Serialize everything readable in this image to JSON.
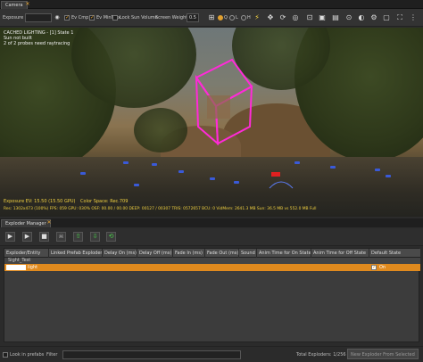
{
  "camera_panel": {
    "tab_label": "Camera",
    "toolbar": {
      "exposure_label": "Exposure",
      "ev_cmp_label": "Ev Cmp",
      "ev_minmax_label": "Ev MinMax",
      "lock_sun_label": "Lock Sun Volume",
      "screen_weight_label": "Screen Weight",
      "screen_weight_value": "0.5",
      "view_modes": [
        "Q",
        "L",
        "H"
      ]
    },
    "overlay": {
      "line1": "CACHED LIGHTING - [1] State 1",
      "line2": "Sun not built",
      "line3": "2 of 2 probes need raytracing",
      "exposure_text": "Exposure EV: 15.50 (15.50 GPU)",
      "color_space_text": "Color Space: Rec.709",
      "stats_text": "Res: 1302x473 (100%)  FPS: 059  GPU: 030%  OSF: 00.00 / 00.00  DEEP: 00127 / 00307  TRIS: 0572657  BCU: 0  VidMem: 2641.3 MB  Sun: 36.5 MB vs 552.0 MB Full"
    }
  },
  "exploder_manager": {
    "tab_label": "Exploder Manager",
    "columns": [
      "Exploder/Entity",
      "Linked Prefab Exploder",
      "Delay On (ms)",
      "Delay Off (ms)",
      "Fade In (ms)",
      "Fade Out (ms)",
      "Sound",
      "Anim Time for On State",
      "Anim Time for Off State",
      "Default State"
    ],
    "sub_row_label": "Sight_Test",
    "rows": [
      {
        "name": "light",
        "default_state": "On"
      }
    ],
    "status": {
      "look_in_prefabs": "Look in prefabs",
      "filter_label": "Filter",
      "total_exploders": "Total Exploders: 1/256",
      "new_exploder_button": "New Exploder From Selected"
    }
  },
  "colors": {
    "selection_row": "#e08a1e",
    "gizmo": "#ff2ad8",
    "probe_blue": "#3a5ad8",
    "overlay_yellow": "#f0d040"
  }
}
